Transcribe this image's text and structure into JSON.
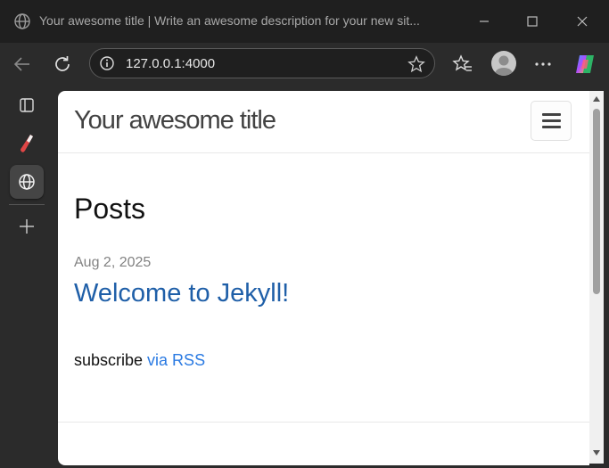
{
  "window": {
    "title": "Your awesome title | Write an awesome description for your new sit...",
    "controls": [
      "minimize-icon",
      "maximize-icon",
      "close-icon"
    ]
  },
  "toolbar": {
    "url": "127.0.0.1:4000",
    "icons": [
      "back-icon",
      "refresh-icon",
      "info-icon",
      "favorite-star-icon",
      "favorites-icon",
      "profile-avatar",
      "more-icon",
      "copilot-icon"
    ]
  },
  "sidebar": {
    "items": [
      "tab-actions-icon",
      "labs-flask-icon",
      "globe-tab-icon",
      "add-icon"
    ]
  },
  "page": {
    "site_title": "Your awesome title",
    "posts_heading": "Posts",
    "posts": [
      {
        "date": "Aug 2, 2025",
        "title": "Welcome to Jekyll!"
      }
    ],
    "subscribe_text": "subscribe ",
    "subscribe_link": "via RSS",
    "link_color": "#2a7ae2"
  }
}
